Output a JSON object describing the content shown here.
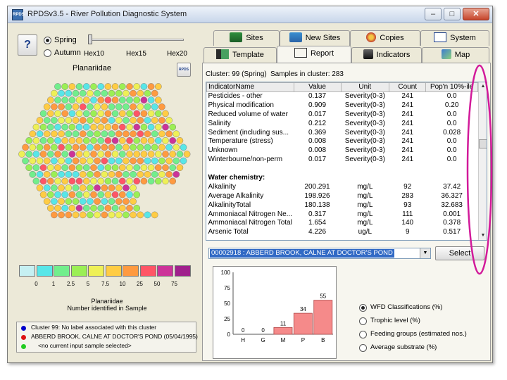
{
  "window": {
    "title": "RPDSv3.5 - River Pollution Diagnostic System",
    "icon_text": "RPDS",
    "minimize": "–",
    "maximize": "□",
    "close": "✕"
  },
  "season": {
    "help": "?",
    "options": [
      "Spring",
      "Autumn"
    ],
    "selected": "Spring",
    "slider_ticks": [
      "Hex10",
      "Hex15",
      "Hex20"
    ]
  },
  "map": {
    "title": "Planariidae",
    "badge": "RPDS",
    "legend_values": [
      "0",
      "1",
      "2.5",
      "5",
      "7.5",
      "10",
      "25",
      "50",
      "75"
    ],
    "legend_colors": [
      "#c6f0f2",
      "#58e6e8",
      "#72ee8c",
      "#9bef55",
      "#eef057",
      "#ffcc44",
      "#ff9a40",
      "#ff5566",
      "#cc3399",
      "#a0208c"
    ],
    "legend_title": "Planariidae",
    "legend_subtitle": "Number identified in Sample"
  },
  "cluster_info": [
    {
      "color": "#0000cc",
      "text": "Cluster 99: No label associated with this cluster"
    },
    {
      "color": "#dd1111",
      "text": "ABBERD BROOK, CALNE AT DOCTOR'S POND (05/04/1995)"
    },
    {
      "color": "#22cc22",
      "text": "<no current input sample selected>"
    }
  ],
  "top_tabs": [
    "Sites",
    "New Sites",
    "Copies",
    "System"
  ],
  "sub_tabs": [
    "Template",
    "Report",
    "Indicators",
    "Map"
  ],
  "active_sub_tab": "Report",
  "report": {
    "header_left": "Cluster: 99 (Spring)",
    "header_right": "Samples in cluster: 283",
    "columns": [
      "IndicatorName",
      "Value",
      "Unit",
      "Count",
      "Pop'n 10%-ile"
    ],
    "rows": [
      [
        "Pesticides - other",
        "0.137",
        "Severity(0-3)",
        "241",
        "0.0"
      ],
      [
        "Physical modification",
        "0.909",
        "Severity(0-3)",
        "241",
        "0.20"
      ],
      [
        "Reduced volume of water",
        "0.017",
        "Severity(0-3)",
        "241",
        "0.0"
      ],
      [
        "Salinity",
        "0.212",
        "Severity(0-3)",
        "241",
        "0.0"
      ],
      [
        "Sediment (including sus...",
        "0.369",
        "Severity(0-3)",
        "241",
        "0.028"
      ],
      [
        "Temperature (stress)",
        "0.008",
        "Severity(0-3)",
        "241",
        "0.0"
      ],
      [
        "Unknown",
        "0.008",
        "Severity(0-3)",
        "241",
        "0.0"
      ],
      [
        "Winterbourne/non-perm",
        "0.017",
        "Severity(0-3)",
        "241",
        "0.0"
      ],
      [
        "",
        "",
        "",
        "",
        ""
      ],
      [
        "Water chemistry:",
        "",
        "",
        "",
        ""
      ],
      [
        "Alkalinity",
        "200.291",
        "mg/L",
        "92",
        "37.42"
      ],
      [
        "Average Alkalinity",
        "198.926",
        "mg/L",
        "283",
        "36.327"
      ],
      [
        "AlkalinityTotal",
        "180.138",
        "mg/L",
        "93",
        "32.683"
      ],
      [
        "Ammoniacal Nitrogen Ne...",
        "0.317",
        "mg/L",
        "111",
        "0.001"
      ],
      [
        "Ammoniacal Nitrogen Total",
        "1.654",
        "mg/L",
        "140",
        "0.378"
      ],
      [
        "Arsenic Total",
        "4.226",
        "ug/L",
        "9",
        "0.517"
      ]
    ],
    "scroll_up": "▲",
    "scroll_down": "▼"
  },
  "site_select": {
    "value": "00002918 : ABBERD BROOK, CALNE AT DOCTOR'S POND",
    "arrow": "▼",
    "button": "Select"
  },
  "chart_data": {
    "type": "bar",
    "categories": [
      "H",
      "G",
      "M",
      "P",
      "B"
    ],
    "values": [
      0,
      0,
      11,
      34,
      55
    ],
    "ylim": [
      0,
      100
    ],
    "yticks": [
      0,
      25,
      50,
      75,
      100
    ],
    "bar_color": "#f58a8a",
    "grid": false
  },
  "chart_options": [
    {
      "label": "WFD Classifications (%)",
      "selected": true
    },
    {
      "label": "Trophic level (%)",
      "selected": false
    },
    {
      "label": "Feeding groups (estimated nos.)",
      "selected": false
    },
    {
      "label": "Average substrate (%)",
      "selected": false
    }
  ]
}
